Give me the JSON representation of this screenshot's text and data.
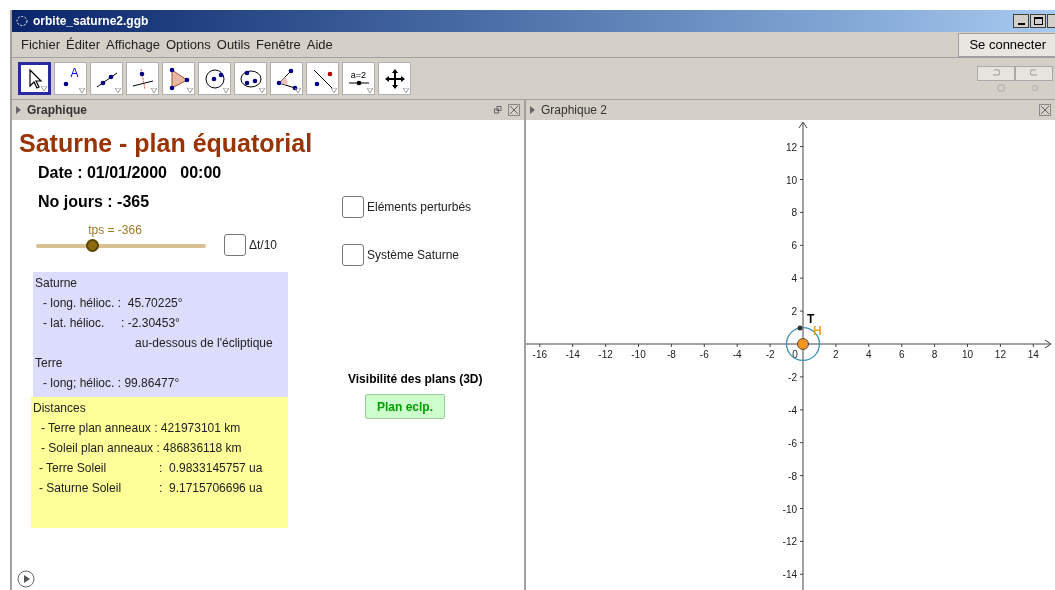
{
  "window": {
    "title": "orbite_saturne2.ggb"
  },
  "menu": [
    "Fichier",
    "Éditer",
    "Affichage",
    "Options",
    "Outils",
    "Fenêtre",
    "Aide"
  ],
  "login_button": "Se connecter",
  "toolbar": [
    {
      "kind": "move",
      "selected": true
    },
    {
      "kind": "point",
      "label": "A",
      "selected": false
    },
    {
      "kind": "line",
      "selected": false
    },
    {
      "kind": "perpendicular",
      "selected": false
    },
    {
      "kind": "polygon",
      "selected": false
    },
    {
      "kind": "circle",
      "selected": false
    },
    {
      "kind": "conic",
      "selected": false
    },
    {
      "kind": "angle",
      "selected": false
    },
    {
      "kind": "reflect",
      "selected": false
    },
    {
      "kind": "slider",
      "label": "a=2",
      "selected": false
    },
    {
      "kind": "move_view",
      "selected": false
    }
  ],
  "graphics": {
    "title": "Graphique",
    "heading": "Saturne - plan équatorial",
    "date": "Date : 01/01/2000   00:00",
    "days": "No jours : -365",
    "slider": {
      "label": "tps = -366",
      "level": 0.335
    },
    "checkboxes": [
      {
        "label": "Δt/10",
        "checked": false
      },
      {
        "label": "Eléments perturbés",
        "checked": false
      },
      {
        "label": "Système Saturne",
        "checked": false
      }
    ],
    "saturne_box": [
      {
        "kind": "heading",
        "text": "Saturne"
      },
      {
        "kind": "line",
        "text": "- long. hélioc. :  45.70225°"
      },
      {
        "kind": "line",
        "text": "- lat. hélioc.     : -2.30453°"
      },
      {
        "kind": "note",
        "text": "au-dessous de l'écliptique"
      },
      {
        "kind": "heading",
        "text": "Terre"
      },
      {
        "kind": "line",
        "text": "- long; hélioc. : 99.86477°"
      }
    ],
    "distance_box": [
      {
        "kind": "heading",
        "text": "Distances"
      },
      {
        "kind": "line",
        "text": "- Terre plan anneaux : 421973101 km"
      },
      {
        "kind": "line",
        "text": "- Soleil plan anneaux : 486836118 km"
      },
      {
        "kind": "row",
        "label": "- Terre Soleil",
        "value": ":  0.9833145757 ua"
      },
      {
        "kind": "row",
        "label": "- Saturne Soleil",
        "value": ":  9.1715706696 ua"
      }
    ],
    "planes_heading": "Visibilité des plans (3D)",
    "plane_button": "Plan eclp."
  },
  "graphics2": {
    "title": "Graphique 2",
    "x_ticks": [
      "-16",
      "-14",
      "-12",
      "-10",
      "-8",
      "-6",
      "-4",
      "-2",
      "0",
      "2",
      "4",
      "6",
      "8",
      "10",
      "12",
      "14"
    ],
    "y_ticks": [
      "12",
      "10",
      "8",
      "6",
      "4",
      "2",
      "-2",
      "-4",
      "-6",
      "-8",
      "-10",
      "-12",
      "-14"
    ],
    "point_labels": [
      {
        "text": "T",
        "color": "#000000"
      },
      {
        "text": "H",
        "color": "#f0a030"
      }
    ]
  }
}
